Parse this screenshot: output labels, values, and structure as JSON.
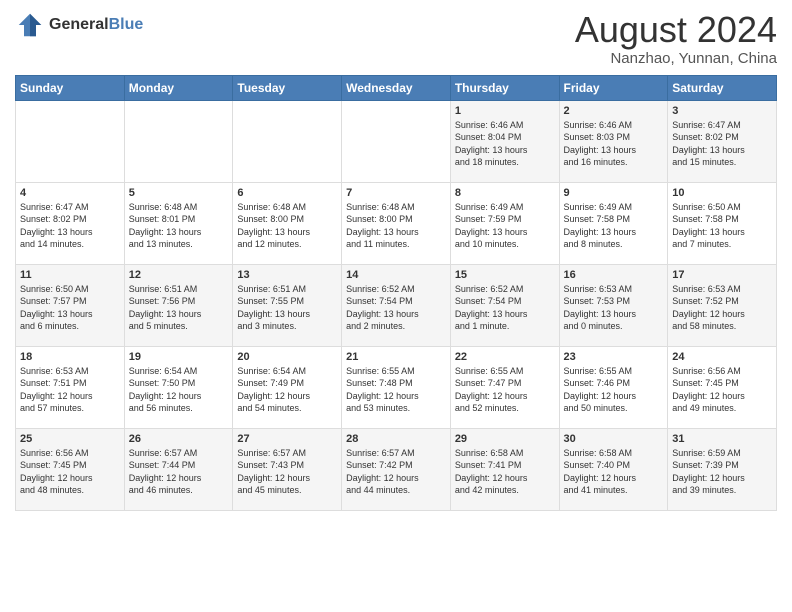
{
  "header": {
    "logo_general": "General",
    "logo_blue": "Blue",
    "month_year": "August 2024",
    "location": "Nanzhao, Yunnan, China"
  },
  "weekdays": [
    "Sunday",
    "Monday",
    "Tuesday",
    "Wednesday",
    "Thursday",
    "Friday",
    "Saturday"
  ],
  "weeks": [
    [
      {
        "day": "",
        "info": ""
      },
      {
        "day": "",
        "info": ""
      },
      {
        "day": "",
        "info": ""
      },
      {
        "day": "",
        "info": ""
      },
      {
        "day": "1",
        "info": "Sunrise: 6:46 AM\nSunset: 8:04 PM\nDaylight: 13 hours\nand 18 minutes."
      },
      {
        "day": "2",
        "info": "Sunrise: 6:46 AM\nSunset: 8:03 PM\nDaylight: 13 hours\nand 16 minutes."
      },
      {
        "day": "3",
        "info": "Sunrise: 6:47 AM\nSunset: 8:02 PM\nDaylight: 13 hours\nand 15 minutes."
      }
    ],
    [
      {
        "day": "4",
        "info": "Sunrise: 6:47 AM\nSunset: 8:02 PM\nDaylight: 13 hours\nand 14 minutes."
      },
      {
        "day": "5",
        "info": "Sunrise: 6:48 AM\nSunset: 8:01 PM\nDaylight: 13 hours\nand 13 minutes."
      },
      {
        "day": "6",
        "info": "Sunrise: 6:48 AM\nSunset: 8:00 PM\nDaylight: 13 hours\nand 12 minutes."
      },
      {
        "day": "7",
        "info": "Sunrise: 6:48 AM\nSunset: 8:00 PM\nDaylight: 13 hours\nand 11 minutes."
      },
      {
        "day": "8",
        "info": "Sunrise: 6:49 AM\nSunset: 7:59 PM\nDaylight: 13 hours\nand 10 minutes."
      },
      {
        "day": "9",
        "info": "Sunrise: 6:49 AM\nSunset: 7:58 PM\nDaylight: 13 hours\nand 8 minutes."
      },
      {
        "day": "10",
        "info": "Sunrise: 6:50 AM\nSunset: 7:58 PM\nDaylight: 13 hours\nand 7 minutes."
      }
    ],
    [
      {
        "day": "11",
        "info": "Sunrise: 6:50 AM\nSunset: 7:57 PM\nDaylight: 13 hours\nand 6 minutes."
      },
      {
        "day": "12",
        "info": "Sunrise: 6:51 AM\nSunset: 7:56 PM\nDaylight: 13 hours\nand 5 minutes."
      },
      {
        "day": "13",
        "info": "Sunrise: 6:51 AM\nSunset: 7:55 PM\nDaylight: 13 hours\nand 3 minutes."
      },
      {
        "day": "14",
        "info": "Sunrise: 6:52 AM\nSunset: 7:54 PM\nDaylight: 13 hours\nand 2 minutes."
      },
      {
        "day": "15",
        "info": "Sunrise: 6:52 AM\nSunset: 7:54 PM\nDaylight: 13 hours\nand 1 minute."
      },
      {
        "day": "16",
        "info": "Sunrise: 6:53 AM\nSunset: 7:53 PM\nDaylight: 13 hours\nand 0 minutes."
      },
      {
        "day": "17",
        "info": "Sunrise: 6:53 AM\nSunset: 7:52 PM\nDaylight: 12 hours\nand 58 minutes."
      }
    ],
    [
      {
        "day": "18",
        "info": "Sunrise: 6:53 AM\nSunset: 7:51 PM\nDaylight: 12 hours\nand 57 minutes."
      },
      {
        "day": "19",
        "info": "Sunrise: 6:54 AM\nSunset: 7:50 PM\nDaylight: 12 hours\nand 56 minutes."
      },
      {
        "day": "20",
        "info": "Sunrise: 6:54 AM\nSunset: 7:49 PM\nDaylight: 12 hours\nand 54 minutes."
      },
      {
        "day": "21",
        "info": "Sunrise: 6:55 AM\nSunset: 7:48 PM\nDaylight: 12 hours\nand 53 minutes."
      },
      {
        "day": "22",
        "info": "Sunrise: 6:55 AM\nSunset: 7:47 PM\nDaylight: 12 hours\nand 52 minutes."
      },
      {
        "day": "23",
        "info": "Sunrise: 6:55 AM\nSunset: 7:46 PM\nDaylight: 12 hours\nand 50 minutes."
      },
      {
        "day": "24",
        "info": "Sunrise: 6:56 AM\nSunset: 7:45 PM\nDaylight: 12 hours\nand 49 minutes."
      }
    ],
    [
      {
        "day": "25",
        "info": "Sunrise: 6:56 AM\nSunset: 7:45 PM\nDaylight: 12 hours\nand 48 minutes."
      },
      {
        "day": "26",
        "info": "Sunrise: 6:57 AM\nSunset: 7:44 PM\nDaylight: 12 hours\nand 46 minutes."
      },
      {
        "day": "27",
        "info": "Sunrise: 6:57 AM\nSunset: 7:43 PM\nDaylight: 12 hours\nand 45 minutes."
      },
      {
        "day": "28",
        "info": "Sunrise: 6:57 AM\nSunset: 7:42 PM\nDaylight: 12 hours\nand 44 minutes."
      },
      {
        "day": "29",
        "info": "Sunrise: 6:58 AM\nSunset: 7:41 PM\nDaylight: 12 hours\nand 42 minutes."
      },
      {
        "day": "30",
        "info": "Sunrise: 6:58 AM\nSunset: 7:40 PM\nDaylight: 12 hours\nand 41 minutes."
      },
      {
        "day": "31",
        "info": "Sunrise: 6:59 AM\nSunset: 7:39 PM\nDaylight: 12 hours\nand 39 minutes."
      }
    ]
  ]
}
